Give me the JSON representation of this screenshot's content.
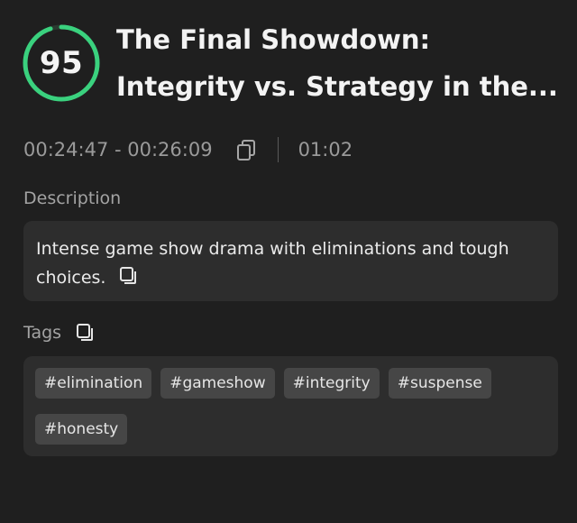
{
  "score": {
    "value": "95",
    "ring_color": "#3ad17e",
    "fraction": 0.95
  },
  "title": {
    "line1": "The Final Showdown:",
    "line2": "Integrity vs. Strategy in the..."
  },
  "timing": {
    "range": "00:24:47 - 00:26:09",
    "duration": "01:02",
    "copy_icon": "copy-icon"
  },
  "description": {
    "label": "Description",
    "text": "Intense game show drama with eliminations and tough choices."
  },
  "tags": {
    "label": "Tags",
    "items": [
      "#elimination",
      "#gameshow",
      "#integrity",
      "#suspense",
      "#honesty"
    ]
  }
}
